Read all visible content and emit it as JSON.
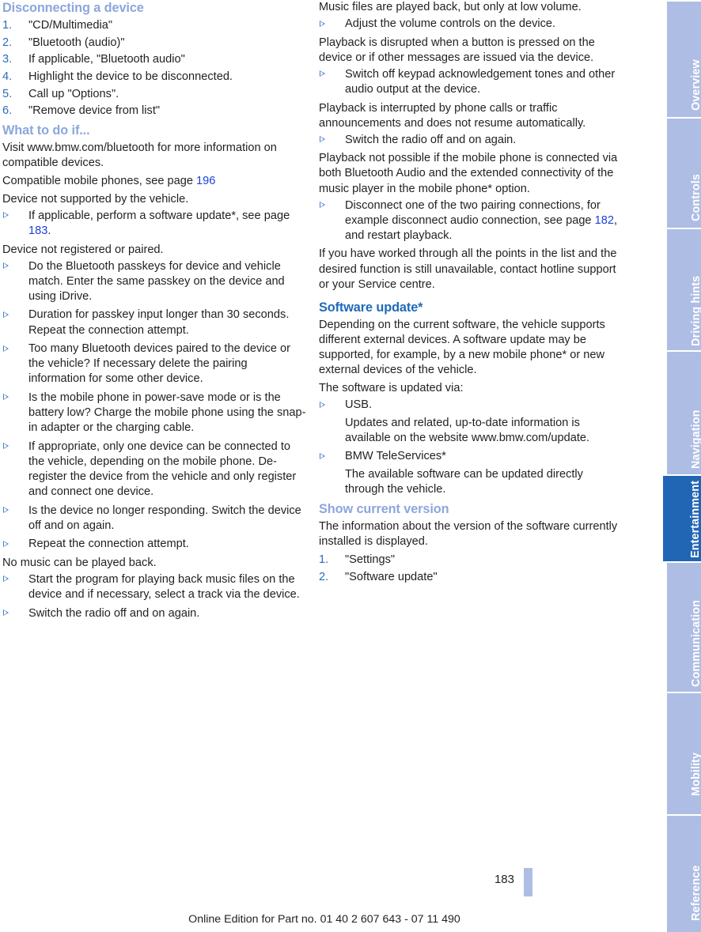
{
  "document": {
    "page_number": "183",
    "edition_line": "Online Edition for Part no. 01 40 2 607 643 - 07 11 490"
  },
  "colors": {
    "heading_light_blue": "#8ca6dd",
    "heading_strong_blue": "#1f6ab8",
    "list_number_blue": "#2a6ebb",
    "bullet_blue": "#3f7fd0",
    "page_ref_blue": "#1b42d8",
    "tab_inactive": "#aebde4",
    "tab_active": "#2166b5",
    "text": "#231f20"
  },
  "tabs": [
    {
      "label": "Overview",
      "active": false
    },
    {
      "label": "Controls",
      "active": false
    },
    {
      "label": "Driving hints",
      "active": false
    },
    {
      "label": "Navigation",
      "active": false
    },
    {
      "label": "Entertainment",
      "active": true
    },
    {
      "label": "Communication",
      "active": false
    },
    {
      "label": "Mobility",
      "active": false
    },
    {
      "label": "Reference",
      "active": false
    }
  ],
  "left_column": {
    "heading_disconnect": "Disconnecting a device",
    "disconnect_steps": [
      "\"CD/Multimedia\"",
      "\"Bluetooth (audio)\"",
      "If applicable, \"Bluetooth audio\"",
      "Highlight the device to be disconnected.",
      "Call up \"Options\".",
      "\"Remove device from list\""
    ],
    "heading_what_to_do": "What to do if...",
    "para_visit_pre": "Visit www.bmw.com/bluetooth for more information on compatible devices.",
    "para_compatible_pre": "Compatible mobile phones, see page ",
    "para_compatible_ref": "196",
    "para_compatible_post": "",
    "cond_not_supported": "Device not supported by the vehicle.",
    "bullet_software_update_pre": "If applicable, perform a software update*, see page ",
    "bullet_software_update_ref": "183",
    "bullet_software_update_post": ".",
    "cond_not_registered": "Device not registered or paired.",
    "bullets_not_registered": [
      "Do the Bluetooth passkeys for device and vehicle match. Enter the same passkey on the device and using iDrive.",
      "Duration for passkey input longer than 30 seconds. Repeat the connection attempt.",
      "Too many Bluetooth devices paired to the device or the vehicle? If necessary delete the pairing information for some other device.",
      "Is the mobile phone in power-save mode or is the battery low? Charge the mobile phone using the snap-in adapter or the charging cable.",
      "If appropriate, only one device can be connected to the vehicle, depending on the mobile phone. De-register the device from the vehicle and only register and connect one device.",
      "Is the device no longer responding. Switch the device off and on again.",
      "Repeat the connection attempt."
    ],
    "cond_no_music": "No music can be played back.",
    "bullets_no_music": [
      "Start the program for playing back music files on the device and if necessary, select a track via the device.",
      "Switch the radio off and on again."
    ]
  },
  "right_column": {
    "cond_low_volume": "Music files are played back, but only at low volume.",
    "bullets_low_volume": [
      "Adjust the volume controls on the device."
    ],
    "cond_disrupted": "Playback is disrupted when a button is pressed on the device or if other messages are issued via the device.",
    "bullets_disrupted": [
      "Switch off keypad acknowledgement tones and other audio output at the device."
    ],
    "cond_interrupted": "Playback is interrupted by phone calls or traffic announcements and does not resume automatically.",
    "bullets_interrupted": [
      "Switch the radio off and on again."
    ],
    "cond_not_possible": "Playback not possible if the mobile phone is connected via both Bluetooth Audio and the extended connectivity of the music player in the mobile phone* option.",
    "bullet_disconnect_pre": "Disconnect one of the two pairing connections, for example disconnect audio connection, see page ",
    "bullet_disconnect_ref": "182",
    "bullet_disconnect_post": ", and restart playback.",
    "para_hotline": "If you have worked through all the points in the list and the desired function is still unavailable, contact hotline support or your Service centre.",
    "heading_software_update": "Software update*",
    "para_depending": "Depending on the current software, the vehicle supports different external devices. A software update may be supported, for example, by a new mobile phone* or new external devices of the vehicle.",
    "para_updated_via": "The software is updated via:",
    "bullets_update_methods": [
      {
        "label": "USB.",
        "sub": "Updates and related, up-to-date information is available on the website www.bmw.com/update."
      },
      {
        "label": "BMW TeleServices*",
        "sub": "The available software can be updated directly through the vehicle."
      }
    ],
    "heading_show_version": "Show current version",
    "para_show_version": "The information about the version of the software currently installed is displayed.",
    "version_steps": [
      "\"Settings\"",
      "\"Software update\""
    ]
  }
}
